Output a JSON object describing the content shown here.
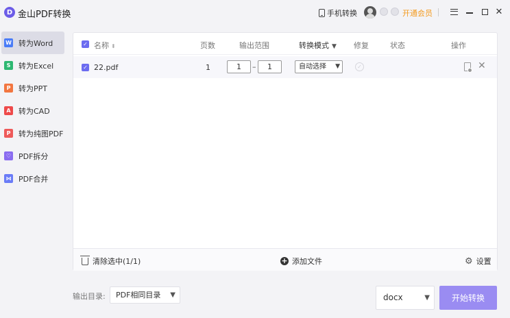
{
  "app": {
    "title": "金山PDF转换",
    "logo_letter": "D",
    "accent_color": "#6c6cf0"
  },
  "titlebar": {
    "mobile_convert": "手机转换",
    "vip": "开通会员",
    "close_glyph": "✕"
  },
  "sidebar": {
    "items": [
      {
        "label": "转为Word",
        "icon": "W",
        "color": "#4a7cf7",
        "active": true
      },
      {
        "label": "转为Excel",
        "icon": "S",
        "color": "#2eb872",
        "active": false
      },
      {
        "label": "转为PPT",
        "icon": "P",
        "color": "#f27640",
        "active": false
      },
      {
        "label": "转为CAD",
        "icon": "A",
        "color": "#ee4a4a",
        "active": false
      },
      {
        "label": "转为纯图PDF",
        "icon": "P",
        "color": "#ee5a5a",
        "active": false
      },
      {
        "label": "PDF拆分",
        "icon": "♡",
        "color": "#8a6cf0",
        "active": false
      },
      {
        "label": "PDF合并",
        "icon": "⋈",
        "color": "#6a7cf7",
        "active": false
      }
    ]
  },
  "table": {
    "headers": {
      "name": "名称",
      "pages": "页数",
      "range": "输出范围",
      "mode": "转换模式",
      "repair": "修复",
      "status": "状态",
      "actions": "操作"
    },
    "rows": [
      {
        "checked": true,
        "name": "22.pdf",
        "pages": "1",
        "range_from": "1",
        "range_to": "1",
        "mode": "自动选择",
        "status": ""
      }
    ]
  },
  "footer": {
    "clear_selected": "清除选中(1/1)",
    "add_file": "添加文件",
    "settings": "设置"
  },
  "bottom": {
    "output_label": "输出目录:",
    "output_dir": "PDF相同目录",
    "format": "docx",
    "start": "开始转换"
  }
}
